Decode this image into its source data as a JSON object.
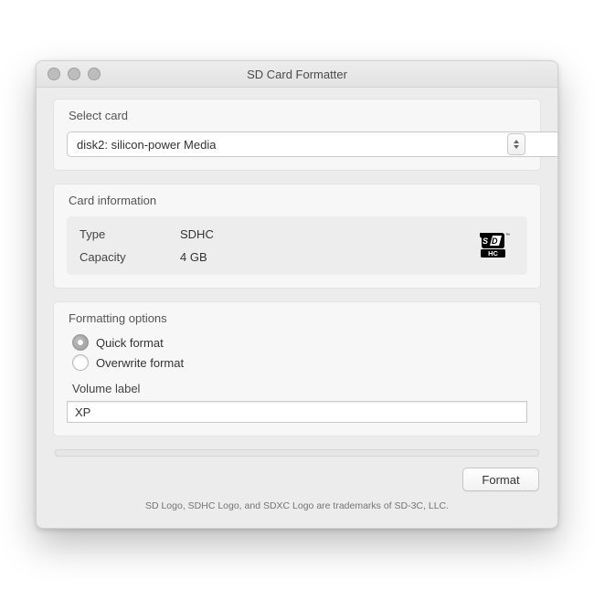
{
  "window": {
    "title": "SD Card Formatter"
  },
  "select_card": {
    "label": "Select card",
    "selected": "disk2: silicon-power Media"
  },
  "card_info": {
    "label": "Card information",
    "type_label": "Type",
    "type_value": "SDHC",
    "capacity_label": "Capacity",
    "capacity_value": "4 GB",
    "logo_name": "SDHC"
  },
  "formatting": {
    "label": "Formatting options",
    "options": {
      "quick": {
        "label": "Quick format",
        "checked": true
      },
      "overwrite": {
        "label": "Overwrite format",
        "checked": false
      }
    },
    "volume_label_caption": "Volume label",
    "volume_label_value": "XP"
  },
  "actions": {
    "format": "Format"
  },
  "footer": {
    "trademark": "SD Logo, SDHC Logo, and SDXC Logo are trademarks of SD-3C, LLC."
  }
}
